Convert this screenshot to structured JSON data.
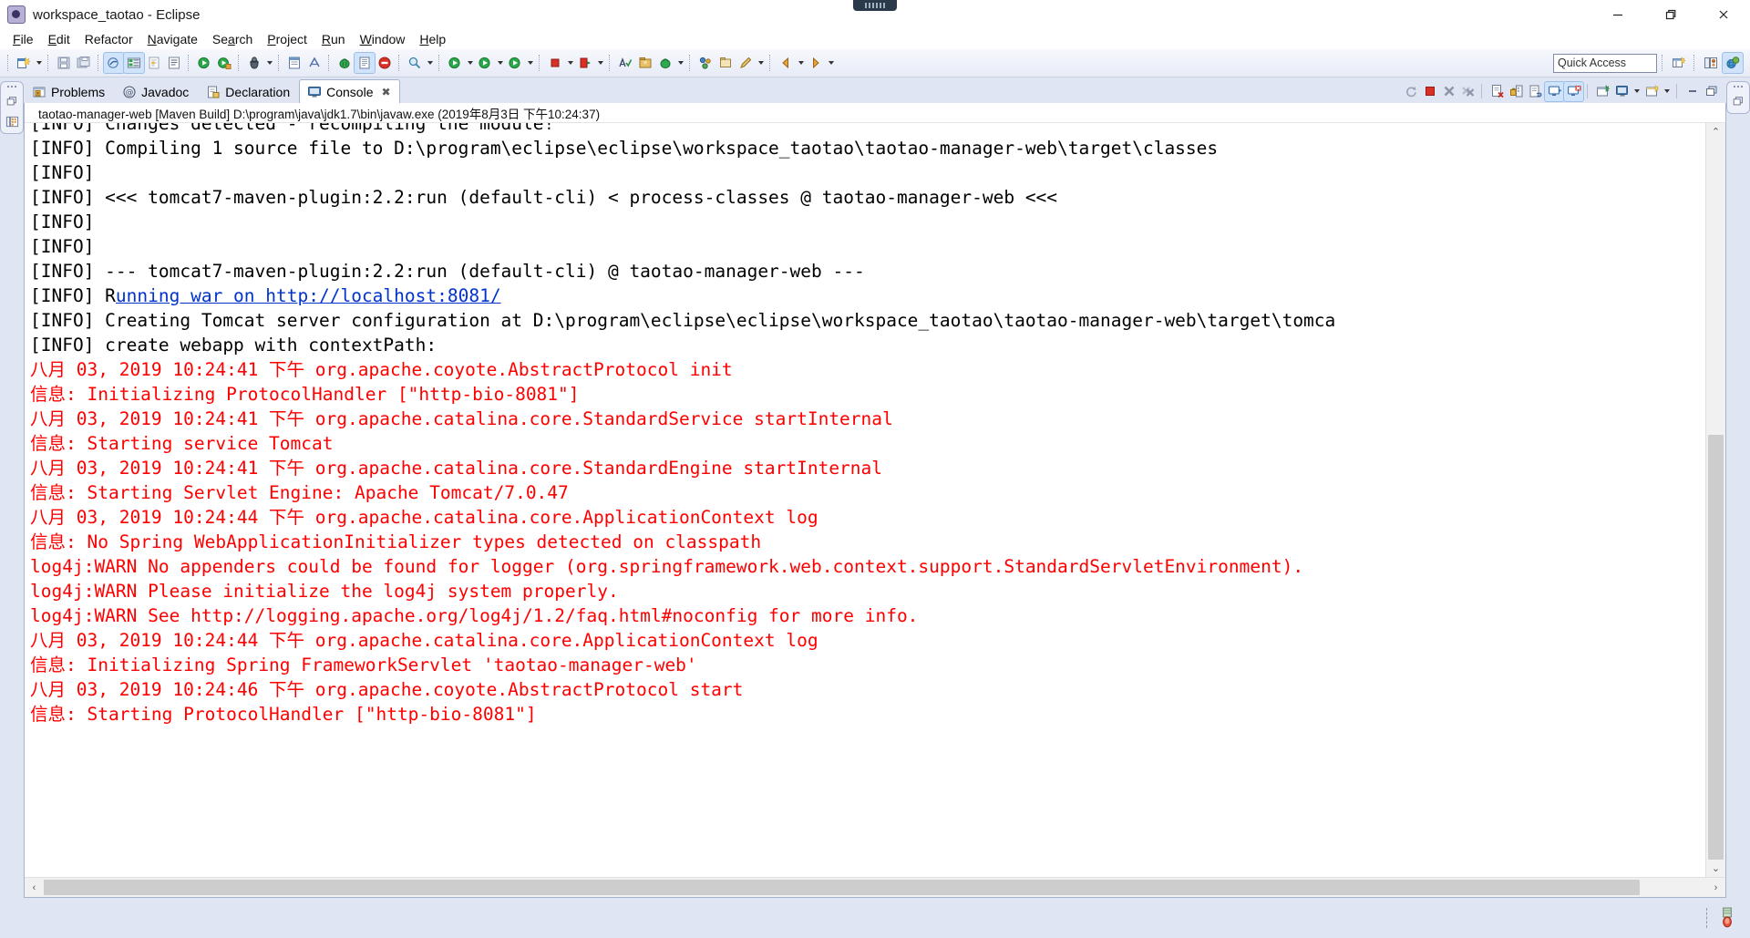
{
  "window": {
    "title": "workspace_taotao - Eclipse",
    "app_icon": "eclipse-icon",
    "minimize_label": "—",
    "maximize_label": "❐",
    "close_label": "✕"
  },
  "menubar": {
    "items": [
      {
        "label": "File",
        "mnemonic": "F"
      },
      {
        "label": "Edit",
        "mnemonic": "E"
      },
      {
        "label": "Refactor",
        "mnemonic": "R"
      },
      {
        "label": "Navigate",
        "mnemonic": "N"
      },
      {
        "label": "Search",
        "mnemonic": "a"
      },
      {
        "label": "Project",
        "mnemonic": "P"
      },
      {
        "label": "Run",
        "mnemonic": "R"
      },
      {
        "label": "Window",
        "mnemonic": "W"
      },
      {
        "label": "Help",
        "mnemonic": "H"
      }
    ]
  },
  "toolbar": {
    "buttons": [
      {
        "name": "new-wizard-icon",
        "has_arrow": true
      },
      {
        "name": "save-icon",
        "has_arrow": false
      },
      {
        "name": "save-all-icon",
        "has_arrow": false
      },
      {
        "name": "toggle-java-editor-icon",
        "has_arrow": false
      },
      {
        "name": "build-all-icon",
        "has_arrow": false
      },
      {
        "name": "skip-breakpoints-icon",
        "has_arrow": false
      },
      {
        "name": "open-task-icon",
        "has_arrow": false
      },
      {
        "name": "run-icon",
        "has_arrow": false
      },
      {
        "name": "run-last-tool-icon",
        "has_arrow": false
      },
      {
        "name": "debug-icon",
        "has_arrow": true
      },
      {
        "name": "new-java-class-icon",
        "has_arrow": false
      },
      {
        "name": "new-annotation-icon",
        "has_arrow": false
      },
      {
        "name": "maven-build-icon",
        "has_arrow": false
      },
      {
        "name": "open-type-icon",
        "has_arrow": false
      },
      {
        "name": "error-marker-icon",
        "has_arrow": false
      },
      {
        "name": "search-icon",
        "has_arrow": true
      },
      {
        "name": "run-as-icon",
        "has_arrow": true
      },
      {
        "name": "run-configurations-icon",
        "has_arrow": true
      },
      {
        "name": "coverage-icon",
        "has_arrow": true
      },
      {
        "name": "terminate-icon",
        "has_arrow": true
      },
      {
        "name": "stop-server-icon",
        "has_arrow": true
      },
      {
        "name": "spell-check-icon",
        "has_arrow": false
      },
      {
        "name": "external-tools-icon",
        "has_arrow": false
      },
      {
        "name": "profile-icon",
        "has_arrow": true
      },
      {
        "name": "svn-commit-icon",
        "has_arrow": false
      },
      {
        "name": "svn-update-icon",
        "has_arrow": false
      },
      {
        "name": "pencil-icon",
        "has_arrow": true
      },
      {
        "name": "back-icon",
        "has_arrow": true
      },
      {
        "name": "forward-icon",
        "has_arrow": true
      }
    ],
    "quick_access": {
      "name": "quick-access-field",
      "placeholder": "Quick Access",
      "value": "Quick Access"
    },
    "perspective_buttons": [
      {
        "name": "open-perspective-icon"
      },
      {
        "name": "java-perspective-icon"
      },
      {
        "name": "java-ee-perspective-icon"
      }
    ]
  },
  "left_trim": {
    "buttons": [
      {
        "name": "restore-view-icon"
      },
      {
        "name": "package-explorer-icon"
      }
    ]
  },
  "right_trim": {
    "buttons": [
      {
        "name": "restore-view-icon"
      }
    ]
  },
  "view_tabs": {
    "tabs": [
      {
        "label": "Problems",
        "icon": "problems-icon",
        "selected": false,
        "closeable": false
      },
      {
        "label": "Javadoc",
        "icon": "javadoc-icon",
        "selected": false,
        "closeable": false
      },
      {
        "label": "Declaration",
        "icon": "declaration-icon",
        "selected": false,
        "closeable": false
      },
      {
        "label": "Console",
        "icon": "console-icon",
        "selected": true,
        "closeable": true
      }
    ],
    "close_glyph": "✖",
    "toolbar": [
      {
        "name": "relaunch-icon",
        "active": false
      },
      {
        "name": "terminate-icon",
        "active": false
      },
      {
        "name": "remove-launch-icon",
        "active": false
      },
      {
        "name": "remove-all-launches-icon",
        "active": false
      },
      {
        "name": "clear-console-icon",
        "active": false
      },
      {
        "name": "scroll-lock-icon",
        "active": false
      },
      {
        "name": "word-wrap-icon",
        "active": false
      },
      {
        "name": "show-console-on-output-icon",
        "active": true
      },
      {
        "name": "show-console-on-error-icon",
        "active": true
      },
      {
        "name": "pin-console-icon",
        "active": false
      },
      {
        "name": "display-selected-console-icon",
        "active": false
      },
      {
        "name": "open-console-icon",
        "active": false
      },
      {
        "name": "minimize-view-icon",
        "active": false
      },
      {
        "name": "maximize-view-icon",
        "active": false
      }
    ]
  },
  "console": {
    "launch_title": "taotao-manager-web [Maven Build] D:\\program\\java\\jdk1.7\\bin\\javaw.exe (2019年8月3日 下午10:24:37)",
    "lines": [
      {
        "color": "black",
        "text": "[INFO] Changes detected - recompiling the module!",
        "clipped_top": true
      },
      {
        "color": "black",
        "text": "[INFO] Compiling 1 source file to D:\\program\\eclipse\\eclipse\\workspace_taotao\\taotao-manager-web\\target\\classes"
      },
      {
        "color": "black",
        "text": "[INFO]"
      },
      {
        "color": "black",
        "text": "[INFO] <<< tomcat7-maven-plugin:2.2:run (default-cli) < process-classes @ taotao-manager-web <<<"
      },
      {
        "color": "black",
        "text": "[INFO]"
      },
      {
        "color": "black",
        "text": "[INFO]"
      },
      {
        "color": "black",
        "text": "[INFO] --- tomcat7-maven-plugin:2.2:run (default-cli) @ taotao-manager-web ---"
      },
      {
        "color": "black",
        "prefix": "[INFO] R",
        "link": "unning war on http://localhost:8081/",
        "is_link_line": true
      },
      {
        "color": "black",
        "text": "[INFO] Creating Tomcat server configuration at D:\\program\\eclipse\\eclipse\\workspace_taotao\\taotao-manager-web\\target\\tomca"
      },
      {
        "color": "black",
        "text": "[INFO] create webapp with contextPath: "
      },
      {
        "color": "red",
        "text": "八月 03, 2019 10:24:41 下午 org.apache.coyote.AbstractProtocol init"
      },
      {
        "color": "red",
        "text": "信息: Initializing ProtocolHandler [\"http-bio-8081\"]"
      },
      {
        "color": "red",
        "text": "八月 03, 2019 10:24:41 下午 org.apache.catalina.core.StandardService startInternal"
      },
      {
        "color": "red",
        "text": "信息: Starting service Tomcat"
      },
      {
        "color": "red",
        "text": "八月 03, 2019 10:24:41 下午 org.apache.catalina.core.StandardEngine startInternal"
      },
      {
        "color": "red",
        "text": "信息: Starting Servlet Engine: Apache Tomcat/7.0.47"
      },
      {
        "color": "red",
        "text": "八月 03, 2019 10:24:44 下午 org.apache.catalina.core.ApplicationContext log"
      },
      {
        "color": "red",
        "text": "信息: No Spring WebApplicationInitializer types detected on classpath"
      },
      {
        "color": "red",
        "text": "log4j:WARN No appenders could be found for logger (org.springframework.web.context.support.StandardServletEnvironment)."
      },
      {
        "color": "red",
        "text": "log4j:WARN Please initialize the log4j system properly."
      },
      {
        "color": "red",
        "text": "log4j:WARN See http://logging.apache.org/log4j/1.2/faq.html#noconfig for more info."
      },
      {
        "color": "red",
        "text": "八月 03, 2019 10:24:44 下午 org.apache.catalina.core.ApplicationContext log"
      },
      {
        "color": "red",
        "text": "信息: Initializing Spring FrameworkServlet 'taotao-manager-web'"
      },
      {
        "color": "red",
        "text": "八月 03, 2019 10:24:46 下午 org.apache.coyote.AbstractProtocol start"
      },
      {
        "color": "red",
        "text": "信息: Starting ProtocolHandler [\"http-bio-8081\"]"
      }
    ]
  },
  "scrollbars": {
    "vertical": {
      "up_glyph": "⌃",
      "down_glyph": "⌄",
      "thumb_top_pct": 41,
      "thumb_height_pct": 59
    },
    "horizontal": {
      "left_glyph": "‹",
      "right_glyph": "›",
      "thumb_left_pct": 0,
      "thumb_width_pct": 96
    }
  },
  "statusbar": {
    "text": "",
    "icon": "tomcat-status-icon"
  },
  "colors": {
    "chrome": "#dfe5f3",
    "console_bg": "#ffffff",
    "error_text": "#ff0000",
    "link_text": "#0033cc",
    "tab_selected_bg": "#ffffff"
  }
}
